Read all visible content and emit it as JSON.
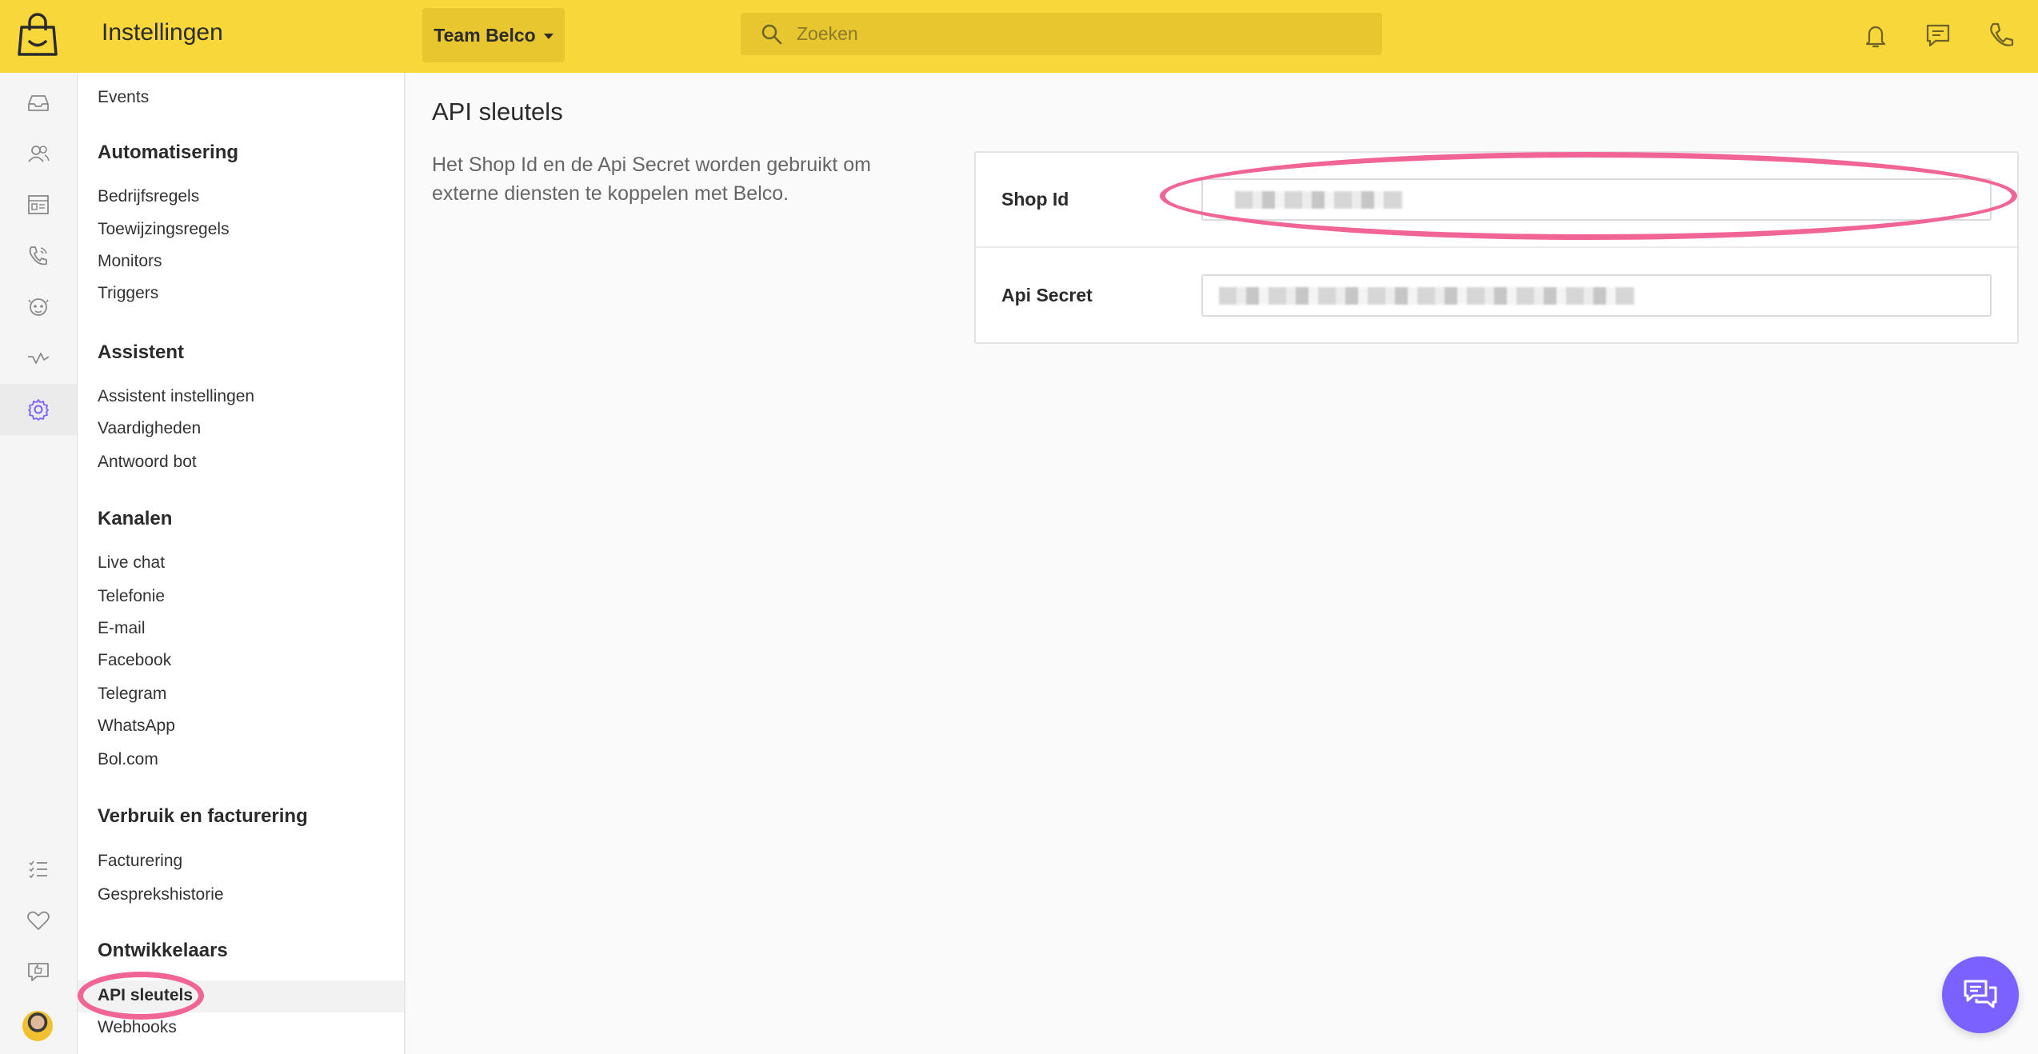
{
  "header": {
    "app_title": "Instellingen",
    "team_label": "Team Belco",
    "search_placeholder": "Zoeken"
  },
  "nav": {
    "top_item": "Events",
    "sections": [
      {
        "title": "Automatisering",
        "items": [
          "Bedrijfsregels",
          "Toewijzingsregels",
          "Monitors",
          "Triggers"
        ]
      },
      {
        "title": "Assistent",
        "items": [
          "Assistent instellingen",
          "Vaardigheden",
          "Antwoord bot"
        ]
      },
      {
        "title": "Kanalen",
        "items": [
          "Live chat",
          "Telefonie",
          "E-mail",
          "Facebook",
          "Telegram",
          "WhatsApp",
          "Bol.com"
        ]
      },
      {
        "title": "Verbruik en facturering",
        "items": [
          "Facturering",
          "Gesprekshistorie"
        ]
      },
      {
        "title": "Ontwikkelaars",
        "items": [
          "API sleutels",
          "Webhooks"
        ]
      }
    ]
  },
  "main": {
    "title": "API sleutels",
    "description": "Het Shop Id en de Api Secret worden gebruikt om externe diensten te koppelen met Belco.",
    "fields": [
      {
        "label": "Shop Id"
      },
      {
        "label": "Api Secret"
      }
    ]
  },
  "colors": {
    "topbar": "#f7d73a",
    "accent": "#7b61ff",
    "highlight": "#f06595"
  }
}
